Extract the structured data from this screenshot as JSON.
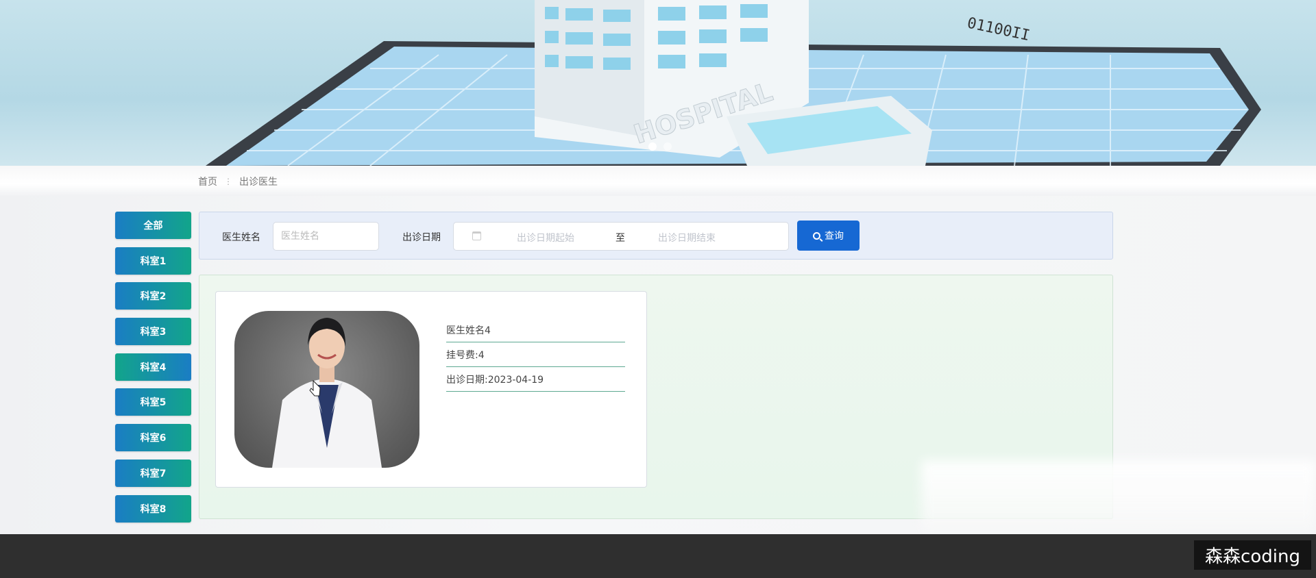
{
  "banner": {
    "sign_text": "HOSPITAL",
    "slides": 2,
    "active_slide": 1
  },
  "breadcrumb": {
    "home": "首页",
    "separator": "⋮",
    "current": "出诊医生"
  },
  "categories": [
    "全部",
    "科室1",
    "科室2",
    "科室3",
    "科室4",
    "科室5",
    "科室6",
    "科室7",
    "科室8"
  ],
  "search": {
    "name_label": "医生姓名",
    "name_placeholder": "医生姓名",
    "date_label": "出诊日期",
    "date_start_placeholder": "出诊日期起始",
    "date_to": "至",
    "date_end_placeholder": "出诊日期结束",
    "query_label": "查询"
  },
  "doctors": [
    {
      "name": "医生姓名4",
      "fee": "挂号费:4",
      "date": "出诊日期:2023-04-19"
    }
  ],
  "watermark": "森森coding",
  "colors": {
    "category_gradient_start": "#1a7dc4",
    "category_gradient_end": "#12a58a",
    "query_button": "#1668d3",
    "footer": "#2f2f2f"
  }
}
